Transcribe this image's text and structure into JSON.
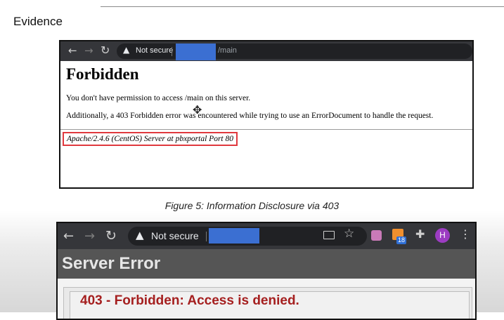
{
  "evidence_heading": "Evidence",
  "screenshot1": {
    "browser": {
      "security_label": "Not secure",
      "url_path": "/main"
    },
    "page": {
      "heading": "Forbidden",
      "message1": "You don't have permission to access /main on this server.",
      "message2": "Additionally, a 403 Forbidden error was encountered while trying to use an ErrorDocument to handle the request.",
      "server_address": "Apache/2.4.6 (CentOS) Server at pbxportal Port 80"
    },
    "highlight_color": "#e0393e"
  },
  "caption": "Figure 5: Information Disclosure via 403",
  "screenshot2": {
    "browser": {
      "security_label": "Not secure",
      "extension_badge": "18",
      "profile_initial": "H"
    },
    "page": {
      "header_title": "Server Error",
      "error_title": "403 - Forbidden: Access is denied."
    },
    "redaction_color": "#3b6fd2",
    "error_color": "#a51f1f"
  }
}
